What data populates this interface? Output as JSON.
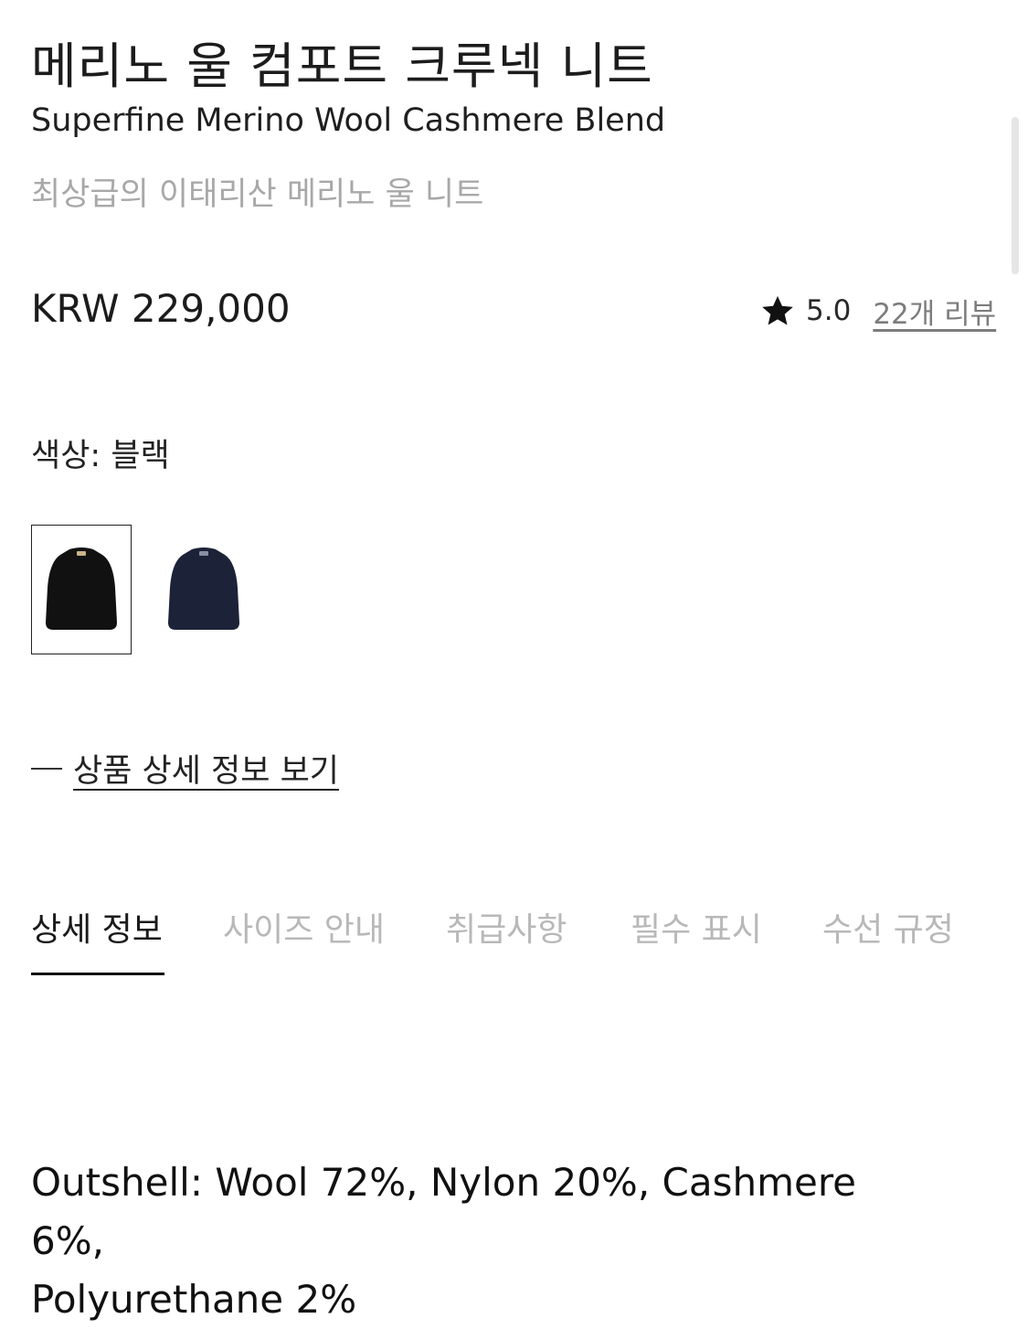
{
  "product": {
    "title": "메리노 울 컴포트 크루넥 니트",
    "subtitle": "Superfine Merino Wool Cashmere Blend",
    "tagline": "최상급의 이태리산 메리노 울 니트",
    "price": "KRW 229,000"
  },
  "rating": {
    "icon": "star-icon",
    "score": "5.0",
    "reviews_label": "22개 리뷰"
  },
  "color": {
    "label": "색상: 블랙",
    "options": [
      {
        "name": "black-swatch",
        "hex": "#111111",
        "selected": true
      },
      {
        "name": "navy-swatch",
        "hex": "#1c2238",
        "selected": false
      }
    ]
  },
  "detail_link": {
    "label": "상품 상세 정보 보기"
  },
  "tabs": [
    {
      "label": "상세 정보",
      "active": true
    },
    {
      "label": "사이즈 안내",
      "active": false
    },
    {
      "label": "취급사항",
      "active": false
    },
    {
      "label": "필수 표시",
      "active": false
    },
    {
      "label": "수선 규정",
      "active": false
    }
  ],
  "composition": {
    "line1": "Outshell: Wool 72%, Nylon 20%, Cashmere 6%,",
    "line2": "Polyurethane 2%"
  }
}
